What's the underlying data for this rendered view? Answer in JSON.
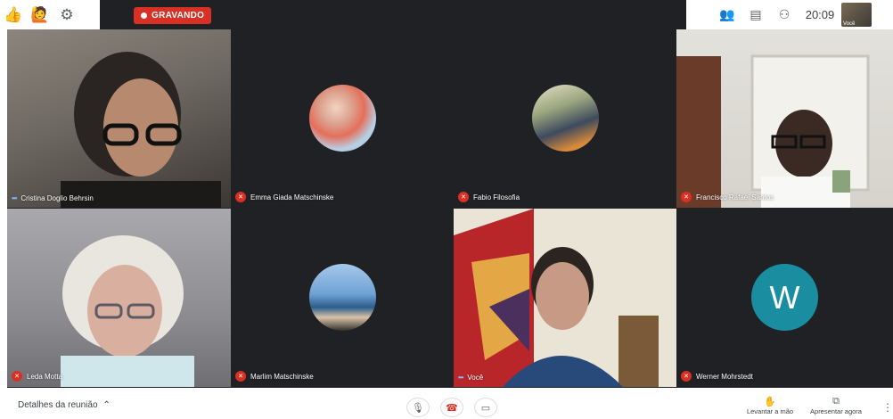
{
  "topbar": {
    "left_icons": [
      {
        "icon": "thumbs-up-icon",
        "glyph": "👍"
      },
      {
        "icon": "raise-hand-person-icon",
        "glyph": "🙋"
      },
      {
        "icon": "gear-icon",
        "glyph": "⚙"
      }
    ],
    "recording_label": "GRAVANDO",
    "right_icons": [
      {
        "icon": "people-icon",
        "glyph": "👥"
      },
      {
        "icon": "chat-icon",
        "glyph": "▤"
      },
      {
        "icon": "activities-icon",
        "glyph": "⚇"
      }
    ],
    "time": "20:09",
    "self_label": "Você"
  },
  "participants": [
    {
      "name": "Cristina Doglio Behrsin",
      "type": "video",
      "speaking": true
    },
    {
      "name": "Emma Giada Matschinske",
      "type": "avatar",
      "muted": true
    },
    {
      "name": "Fabio Filosofia",
      "type": "avatar",
      "muted": true
    },
    {
      "name": "Francisco Rafael Santos",
      "type": "video",
      "muted": true
    },
    {
      "name": "Leda Motta",
      "type": "video",
      "muted": true
    },
    {
      "name": "Marlim Matschinske",
      "type": "avatar",
      "muted": true
    },
    {
      "name": "Você",
      "type": "video",
      "speaking": true
    },
    {
      "name": "Werner Mohrstedt",
      "type": "letter",
      "letter": "W",
      "muted": true
    }
  ],
  "bottombar": {
    "details_label": "Detalhes da reunião",
    "details_icon": "chevron-up-icon",
    "raise_hand_label": "Levantar a mão",
    "present_label": "Apresentar agora"
  },
  "colors": {
    "recording": "#d93025",
    "tile_bg": "#202124",
    "avatar_w": "#1a8ea0"
  }
}
